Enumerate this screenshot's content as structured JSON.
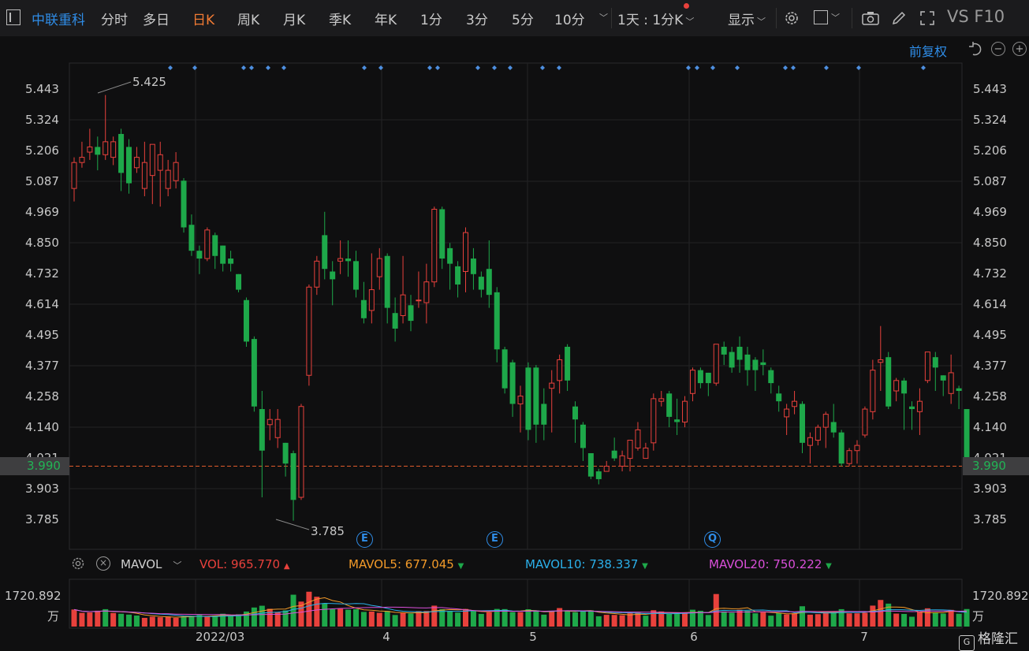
{
  "toolbar": {
    "stock_name": "中联重科",
    "tabs": [
      "分时",
      "多日",
      "日K",
      "周K",
      "月K",
      "季K",
      "年K",
      "1分",
      "3分",
      "5分",
      "10分"
    ],
    "active_tab": "日K",
    "interval": "1天 : 1分K",
    "display": "显示",
    "vs_f10": "VS F10"
  },
  "subbar": {
    "adjust": "前复权"
  },
  "price_axis": {
    "ticks": [
      "5.443",
      "5.324",
      "5.206",
      "5.087",
      "4.969",
      "4.850",
      "4.732",
      "4.614",
      "4.495",
      "4.377",
      "4.258",
      "4.140",
      "4.021",
      "3.903",
      "3.785"
    ],
    "current": "3.990",
    "high_label": "5.425",
    "low_label": "3.785"
  },
  "colors": {
    "up": "#e8413c",
    "down": "#1ea84a",
    "current_line": "#e05a2b",
    "accent": "#2f8de8",
    "mavol5": "#f29a29",
    "mavol10": "#2bb0ea",
    "mavol20": "#d94fd9"
  },
  "event_markers": [
    {
      "label": "E"
    },
    {
      "label": "E"
    },
    {
      "label": "Q"
    }
  ],
  "volume_panel": {
    "indicator": "MAVOL",
    "vol_label": "VOL:",
    "vol_value": "965.770",
    "mavol5_label": "MAVOL5:",
    "mavol5_value": "677.045",
    "mavol10_label": "MAVOL10:",
    "mavol10_value": "738.337",
    "mavol20_label": "MAVOL20:",
    "mavol20_value": "750.222",
    "axis_max": "1720.892",
    "axis_unit": "万"
  },
  "x_axis": {
    "labels": [
      "2022/03",
      "4",
      "5",
      "6",
      "7"
    ]
  },
  "brand": "格隆汇",
  "chart_data": {
    "type": "candlestick",
    "ylim": [
      3.72,
      5.5
    ],
    "current_price": 3.99,
    "candles": [
      [
        5.06,
        5.16,
        5.18,
        5.01
      ],
      [
        5.16,
        5.18,
        5.24,
        5.14
      ],
      [
        5.2,
        5.22,
        5.29,
        5.17
      ],
      [
        5.22,
        5.19,
        5.26,
        5.13
      ],
      [
        5.19,
        5.24,
        5.42,
        5.17
      ],
      [
        5.18,
        5.24,
        5.26,
        5.15
      ],
      [
        5.27,
        5.12,
        5.29,
        5.05
      ],
      [
        5.22,
        5.08,
        5.25,
        5.04
      ],
      [
        5.14,
        5.18,
        5.22,
        5.12
      ],
      [
        5.06,
        5.16,
        5.24,
        5.03
      ],
      [
        5.11,
        5.23,
        5.23,
        5.0
      ],
      [
        5.13,
        5.19,
        5.24,
        4.99
      ],
      [
        5.06,
        5.13,
        5.17,
        5.03
      ],
      [
        5.09,
        5.16,
        5.2,
        5.06
      ],
      [
        5.09,
        4.91,
        5.1,
        4.89
      ],
      [
        4.92,
        4.82,
        4.96,
        4.8
      ],
      [
        4.82,
        4.79,
        4.84,
        4.73
      ],
      [
        4.79,
        4.9,
        4.91,
        4.78
      ],
      [
        4.88,
        4.8,
        4.89,
        4.75
      ],
      [
        4.84,
        4.77,
        4.84,
        4.74
      ],
      [
        4.79,
        4.77,
        4.82,
        4.74
      ],
      [
        4.73,
        4.67,
        4.73,
        4.66
      ],
      [
        4.63,
        4.47,
        4.64,
        4.45
      ],
      [
        4.48,
        4.22,
        4.49,
        4.2
      ],
      [
        4.21,
        4.05,
        4.28,
        3.87
      ],
      [
        4.15,
        4.17,
        4.21,
        4.09
      ],
      [
        4.1,
        4.17,
        4.21,
        4.06
      ],
      [
        4.08,
        4.0,
        4.08,
        3.95
      ],
      [
        4.04,
        3.86,
        4.05,
        3.78
      ],
      [
        3.87,
        4.22,
        4.23,
        3.86
      ],
      [
        4.34,
        4.68,
        4.69,
        4.3
      ],
      [
        4.68,
        4.78,
        4.8,
        4.65
      ],
      [
        4.88,
        4.75,
        4.97,
        4.71
      ],
      [
        4.74,
        4.71,
        4.78,
        4.61
      ],
      [
        4.78,
        4.79,
        4.86,
        4.73
      ],
      [
        4.79,
        4.78,
        4.86,
        4.72
      ],
      [
        4.78,
        4.67,
        4.82,
        4.64
      ],
      [
        4.63,
        4.56,
        4.7,
        4.54
      ],
      [
        4.59,
        4.67,
        4.81,
        4.54
      ],
      [
        4.72,
        4.79,
        4.83,
        4.67
      ],
      [
        4.8,
        4.6,
        4.81,
        4.54
      ],
      [
        4.58,
        4.52,
        4.64,
        4.47
      ],
      [
        4.57,
        4.65,
        4.8,
        4.54
      ],
      [
        4.61,
        4.55,
        4.65,
        4.51
      ],
      [
        4.63,
        4.63,
        4.74,
        4.6
      ],
      [
        4.62,
        4.7,
        4.77,
        4.54
      ],
      [
        4.7,
        4.98,
        4.99,
        4.68
      ],
      [
        4.98,
        4.79,
        4.99,
        4.75
      ],
      [
        4.83,
        4.77,
        4.85,
        4.67
      ],
      [
        4.76,
        4.69,
        4.78,
        4.64
      ],
      [
        4.74,
        4.89,
        4.91,
        4.66
      ],
      [
        4.79,
        4.73,
        4.83,
        4.67
      ],
      [
        4.72,
        4.67,
        4.74,
        4.64
      ],
      [
        4.75,
        4.65,
        4.86,
        4.6
      ],
      [
        4.66,
        4.44,
        4.68,
        4.39
      ],
      [
        4.44,
        4.29,
        4.45,
        4.27
      ],
      [
        4.39,
        4.23,
        4.4,
        4.18
      ],
      [
        4.23,
        4.26,
        4.3,
        4.12
      ],
      [
        4.37,
        4.13,
        4.39,
        4.09
      ],
      [
        4.37,
        4.15,
        4.38,
        4.08
      ],
      [
        4.23,
        4.15,
        4.29,
        4.09
      ],
      [
        4.29,
        4.31,
        4.36,
        4.12
      ],
      [
        4.32,
        4.4,
        4.42,
        4.27
      ],
      [
        4.45,
        4.32,
        4.46,
        4.28
      ],
      [
        4.22,
        4.17,
        4.24,
        4.08
      ],
      [
        4.15,
        4.06,
        4.16,
        4.01
      ],
      [
        4.04,
        3.95,
        4.04,
        3.94
      ],
      [
        3.97,
        3.94,
        3.98,
        3.92
      ],
      [
        3.97,
        3.99,
        4.01,
        3.97
      ],
      [
        4.05,
        4.02,
        4.1,
        4.01
      ],
      [
        3.99,
        4.03,
        4.05,
        3.97
      ],
      [
        4.02,
        4.09,
        4.09,
        3.97
      ],
      [
        4.06,
        4.13,
        4.16,
        4.05
      ],
      [
        4.02,
        4.06,
        4.08,
        4.02
      ],
      [
        4.08,
        4.25,
        4.27,
        4.05
      ],
      [
        4.24,
        4.25,
        4.28,
        4.22
      ],
      [
        4.27,
        4.18,
        4.28,
        4.14
      ],
      [
        4.17,
        4.16,
        4.25,
        4.11
      ],
      [
        4.16,
        4.24,
        4.26,
        4.14
      ],
      [
        4.27,
        4.36,
        4.37,
        4.24
      ],
      [
        4.36,
        4.31,
        4.37,
        4.29
      ],
      [
        4.35,
        4.31,
        4.35,
        4.26
      ],
      [
        4.31,
        4.46,
        4.46,
        4.3
      ],
      [
        4.45,
        4.42,
        4.47,
        4.38
      ],
      [
        4.43,
        4.37,
        4.45,
        4.35
      ],
      [
        4.45,
        4.4,
        4.49,
        4.35
      ],
      [
        4.42,
        4.36,
        4.45,
        4.3
      ],
      [
        4.4,
        4.36,
        4.41,
        4.28
      ],
      [
        4.39,
        4.38,
        4.44,
        4.34
      ],
      [
        4.36,
        4.31,
        4.37,
        4.27
      ],
      [
        4.27,
        4.24,
        4.3,
        4.2
      ],
      [
        4.18,
        4.21,
        4.23,
        4.11
      ],
      [
        4.22,
        4.24,
        4.28,
        4.19
      ],
      [
        4.23,
        4.08,
        4.24,
        4.04
      ],
      [
        4.07,
        4.1,
        4.12,
        4.0
      ],
      [
        4.09,
        4.14,
        4.15,
        4.07
      ],
      [
        4.14,
        4.19,
        4.2,
        4.06
      ],
      [
        4.16,
        4.12,
        4.23,
        4.1
      ],
      [
        4.12,
        4.0,
        4.13,
        3.99
      ],
      [
        4.0,
        4.05,
        4.06,
        3.99
      ],
      [
        4.05,
        4.07,
        4.09,
        4.0
      ],
      [
        4.11,
        4.21,
        4.22,
        4.1
      ],
      [
        4.2,
        4.36,
        4.4,
        4.17
      ],
      [
        4.39,
        4.4,
        4.53,
        4.28
      ],
      [
        4.41,
        4.22,
        4.43,
        4.21
      ],
      [
        4.28,
        4.32,
        4.33,
        4.24
      ],
      [
        4.32,
        4.27,
        4.33,
        4.13
      ],
      [
        4.22,
        4.21,
        4.24,
        4.13
      ],
      [
        4.2,
        4.24,
        4.29,
        4.11
      ],
      [
        4.32,
        4.43,
        4.43,
        4.31
      ],
      [
        4.41,
        4.37,
        4.43,
        4.28
      ],
      [
        4.34,
        4.32,
        4.34,
        4.26
      ],
      [
        4.27,
        4.35,
        4.42,
        4.23
      ],
      [
        4.29,
        4.28,
        4.3,
        4.21
      ],
      [
        4.21,
        3.99,
        4.21,
        3.96
      ]
    ],
    "volume": [
      [
        745,
        1
      ],
      [
        600,
        1
      ],
      [
        618,
        1
      ],
      [
        692,
        1
      ],
      [
        760,
        0
      ],
      [
        593,
        1
      ],
      [
        560,
        0
      ],
      [
        522,
        0
      ],
      [
        481,
        0
      ],
      [
        380,
        1
      ],
      [
        432,
        1
      ],
      [
        408,
        1
      ],
      [
        440,
        1
      ],
      [
        380,
        1
      ],
      [
        446,
        0
      ],
      [
        471,
        0
      ],
      [
        510,
        0
      ],
      [
        436,
        1
      ],
      [
        484,
        0
      ],
      [
        562,
        0
      ],
      [
        458,
        0
      ],
      [
        537,
        0
      ],
      [
        658,
        0
      ],
      [
        832,
        0
      ],
      [
        910,
        0
      ],
      [
        776,
        1
      ],
      [
        621,
        1
      ],
      [
        707,
        0
      ],
      [
        1392,
        0
      ],
      [
        1090,
        1
      ],
      [
        1522,
        1
      ],
      [
        1303,
        1
      ],
      [
        999,
        0
      ],
      [
        759,
        0
      ],
      [
        780,
        1
      ],
      [
        737,
        0
      ],
      [
        756,
        0
      ],
      [
        640,
        0
      ],
      [
        658,
        1
      ],
      [
        600,
        1
      ],
      [
        687,
        0
      ],
      [
        506,
        0
      ],
      [
        594,
        1
      ],
      [
        570,
        0
      ],
      [
        675,
        1
      ],
      [
        681,
        1
      ],
      [
        914,
        1
      ],
      [
        760,
        0
      ],
      [
        683,
        0
      ],
      [
        610,
        0
      ],
      [
        768,
        1
      ],
      [
        670,
        0
      ],
      [
        554,
        0
      ],
      [
        621,
        1
      ],
      [
        770,
        0
      ],
      [
        763,
        0
      ],
      [
        629,
        0
      ],
      [
        630,
        1
      ],
      [
        757,
        0
      ],
      [
        698,
        0
      ],
      [
        521,
        0
      ],
      [
        664,
        1
      ],
      [
        808,
        1
      ],
      [
        680,
        0
      ],
      [
        621,
        0
      ],
      [
        664,
        0
      ],
      [
        709,
        0
      ],
      [
        450,
        0
      ],
      [
        513,
        1
      ],
      [
        509,
        1
      ],
      [
        495,
        1
      ],
      [
        582,
        1
      ],
      [
        611,
        1
      ],
      [
        476,
        0
      ],
      [
        714,
        1
      ],
      [
        660,
        1
      ],
      [
        560,
        0
      ],
      [
        563,
        0
      ],
      [
        572,
        1
      ],
      [
        736,
        0
      ],
      [
        690,
        0
      ],
      [
        505,
        0
      ],
      [
        1421,
        1
      ],
      [
        663,
        0
      ],
      [
        604,
        0
      ],
      [
        732,
        1
      ],
      [
        690,
        0
      ],
      [
        580,
        0
      ],
      [
        620,
        1
      ],
      [
        476,
        0
      ],
      [
        588,
        0
      ],
      [
        532,
        1
      ],
      [
        580,
        1
      ],
      [
        887,
        0
      ],
      [
        520,
        1
      ],
      [
        542,
        1
      ],
      [
        598,
        1
      ],
      [
        614,
        0
      ],
      [
        760,
        0
      ],
      [
        580,
        1
      ],
      [
        580,
        1
      ],
      [
        604,
        1
      ],
      [
        915,
        1
      ],
      [
        1162,
        1
      ],
      [
        1002,
        0
      ],
      [
        566,
        1
      ],
      [
        552,
        0
      ],
      [
        430,
        0
      ],
      [
        662,
        1
      ],
      [
        797,
        1
      ],
      [
        606,
        0
      ],
      [
        568,
        0
      ],
      [
        730,
        1
      ],
      [
        561,
        0
      ],
      [
        766,
        0
      ]
    ]
  }
}
